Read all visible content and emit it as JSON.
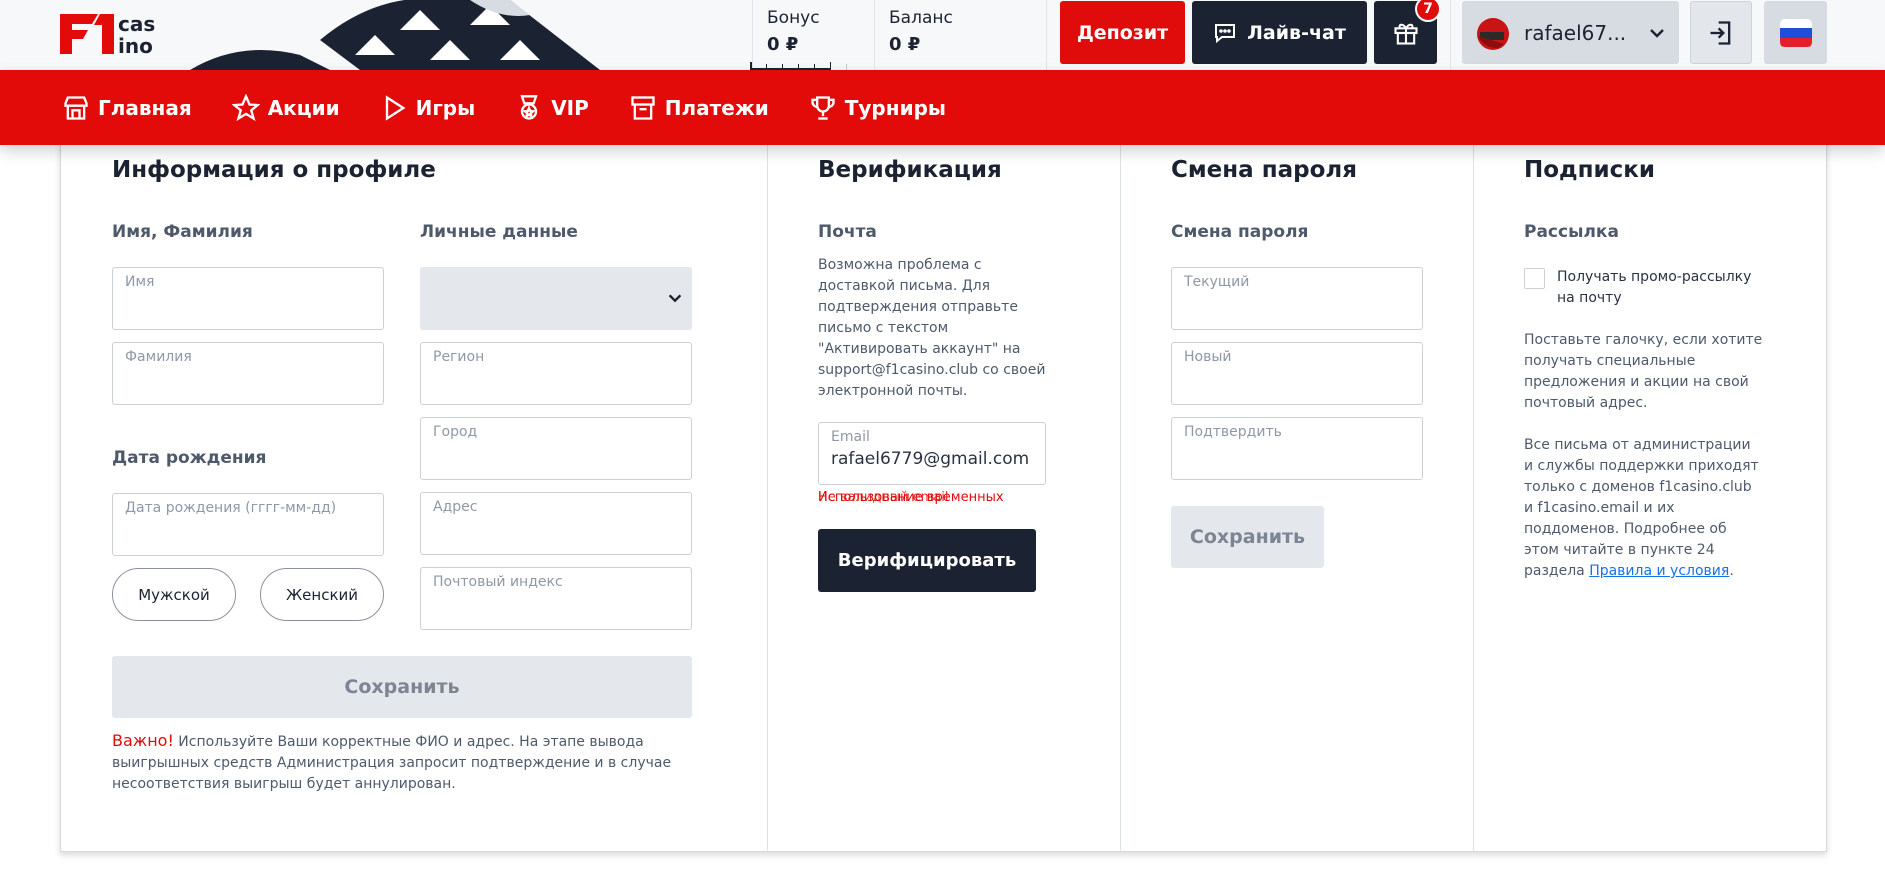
{
  "header": {
    "logo_text": "F1 casino",
    "bonus": {
      "label": "Бонус",
      "value": "0 ₽"
    },
    "balance": {
      "label": "Баланс",
      "value": "0 ₽"
    },
    "deposit_label": "Депозит",
    "livechat_label": "Лайв-чат",
    "gift_badge": "7",
    "username": "rafael67...",
    "language": "ru"
  },
  "nav": {
    "items": [
      {
        "label": "Главная",
        "icon": "home-icon"
      },
      {
        "label": "Акции",
        "icon": "star-icon"
      },
      {
        "label": "Игры",
        "icon": "play-icon"
      },
      {
        "label": "VIP",
        "icon": "vip-icon"
      },
      {
        "label": "Платежи",
        "icon": "payments-icon"
      },
      {
        "label": "Турниры",
        "icon": "trophy-icon"
      }
    ]
  },
  "profile": {
    "title": "Информация о профиле",
    "name_section": "Имя, Фамилия",
    "first_name_placeholder": "Имя",
    "last_name_placeholder": "Фамилия",
    "personal_section": "Личные данные",
    "country_value": "",
    "region_placeholder": "Регион",
    "city_placeholder": "Город",
    "address_placeholder": "Адрес",
    "zip_placeholder": "Почтовый индекс",
    "birth_section": "Дата рождения",
    "birth_placeholder": "Дата рождения (гггг-мм-дд)",
    "male_label": "Мужской",
    "female_label": "Женский",
    "save_label": "Сохранить",
    "important_label": "Важно!",
    "important_text": " Используйте Ваши корректные ФИО и адрес. На этапе вывода выигрышных средств Администрация запросит подтверждение и в случае несоответствия выигрыш будет аннулирован."
  },
  "verification": {
    "title": "Верификация",
    "mail_section": "Почта",
    "mail_note": "Возможна проблема с доставкой письма. Для подтверждения отправьте письмо с текстом \"Активировать аккаунт\" на support@f1casino.club со своей электронной почты.",
    "email_label": "Email",
    "email_value": "rafael6779@gmail.com",
    "error_text_1": "Использование временных",
    "error_text_2": "Не валидный email",
    "verify_label": "Верифицировать"
  },
  "password": {
    "title": "Смена пароля",
    "section": "Смена пароля",
    "current_placeholder": "Текущий",
    "new_placeholder": "Новый",
    "confirm_placeholder": "Подтвердить",
    "save_label": "Сохранить"
  },
  "subscriptions": {
    "title": "Подписки",
    "section": "Рассылка",
    "checkbox_label": "Получать промо-рассылку на почту",
    "checked": false,
    "note_1": "Поставьте галочку, если хотите получать специальные предложения и акции на свой почтовый адрес.",
    "note_2": "Все письма от администрации и службы поддержки приходят только с доменов f1casino.club и f1casino.email и их поддоменов. Подробнее об этом читайте в пункте 24 раздела ",
    "rules_link": "Правила и условия",
    "note_2_end": "."
  },
  "colors": {
    "brand_red": "#e30a0a",
    "dark": "#1b2232",
    "link": "#1473e6"
  }
}
